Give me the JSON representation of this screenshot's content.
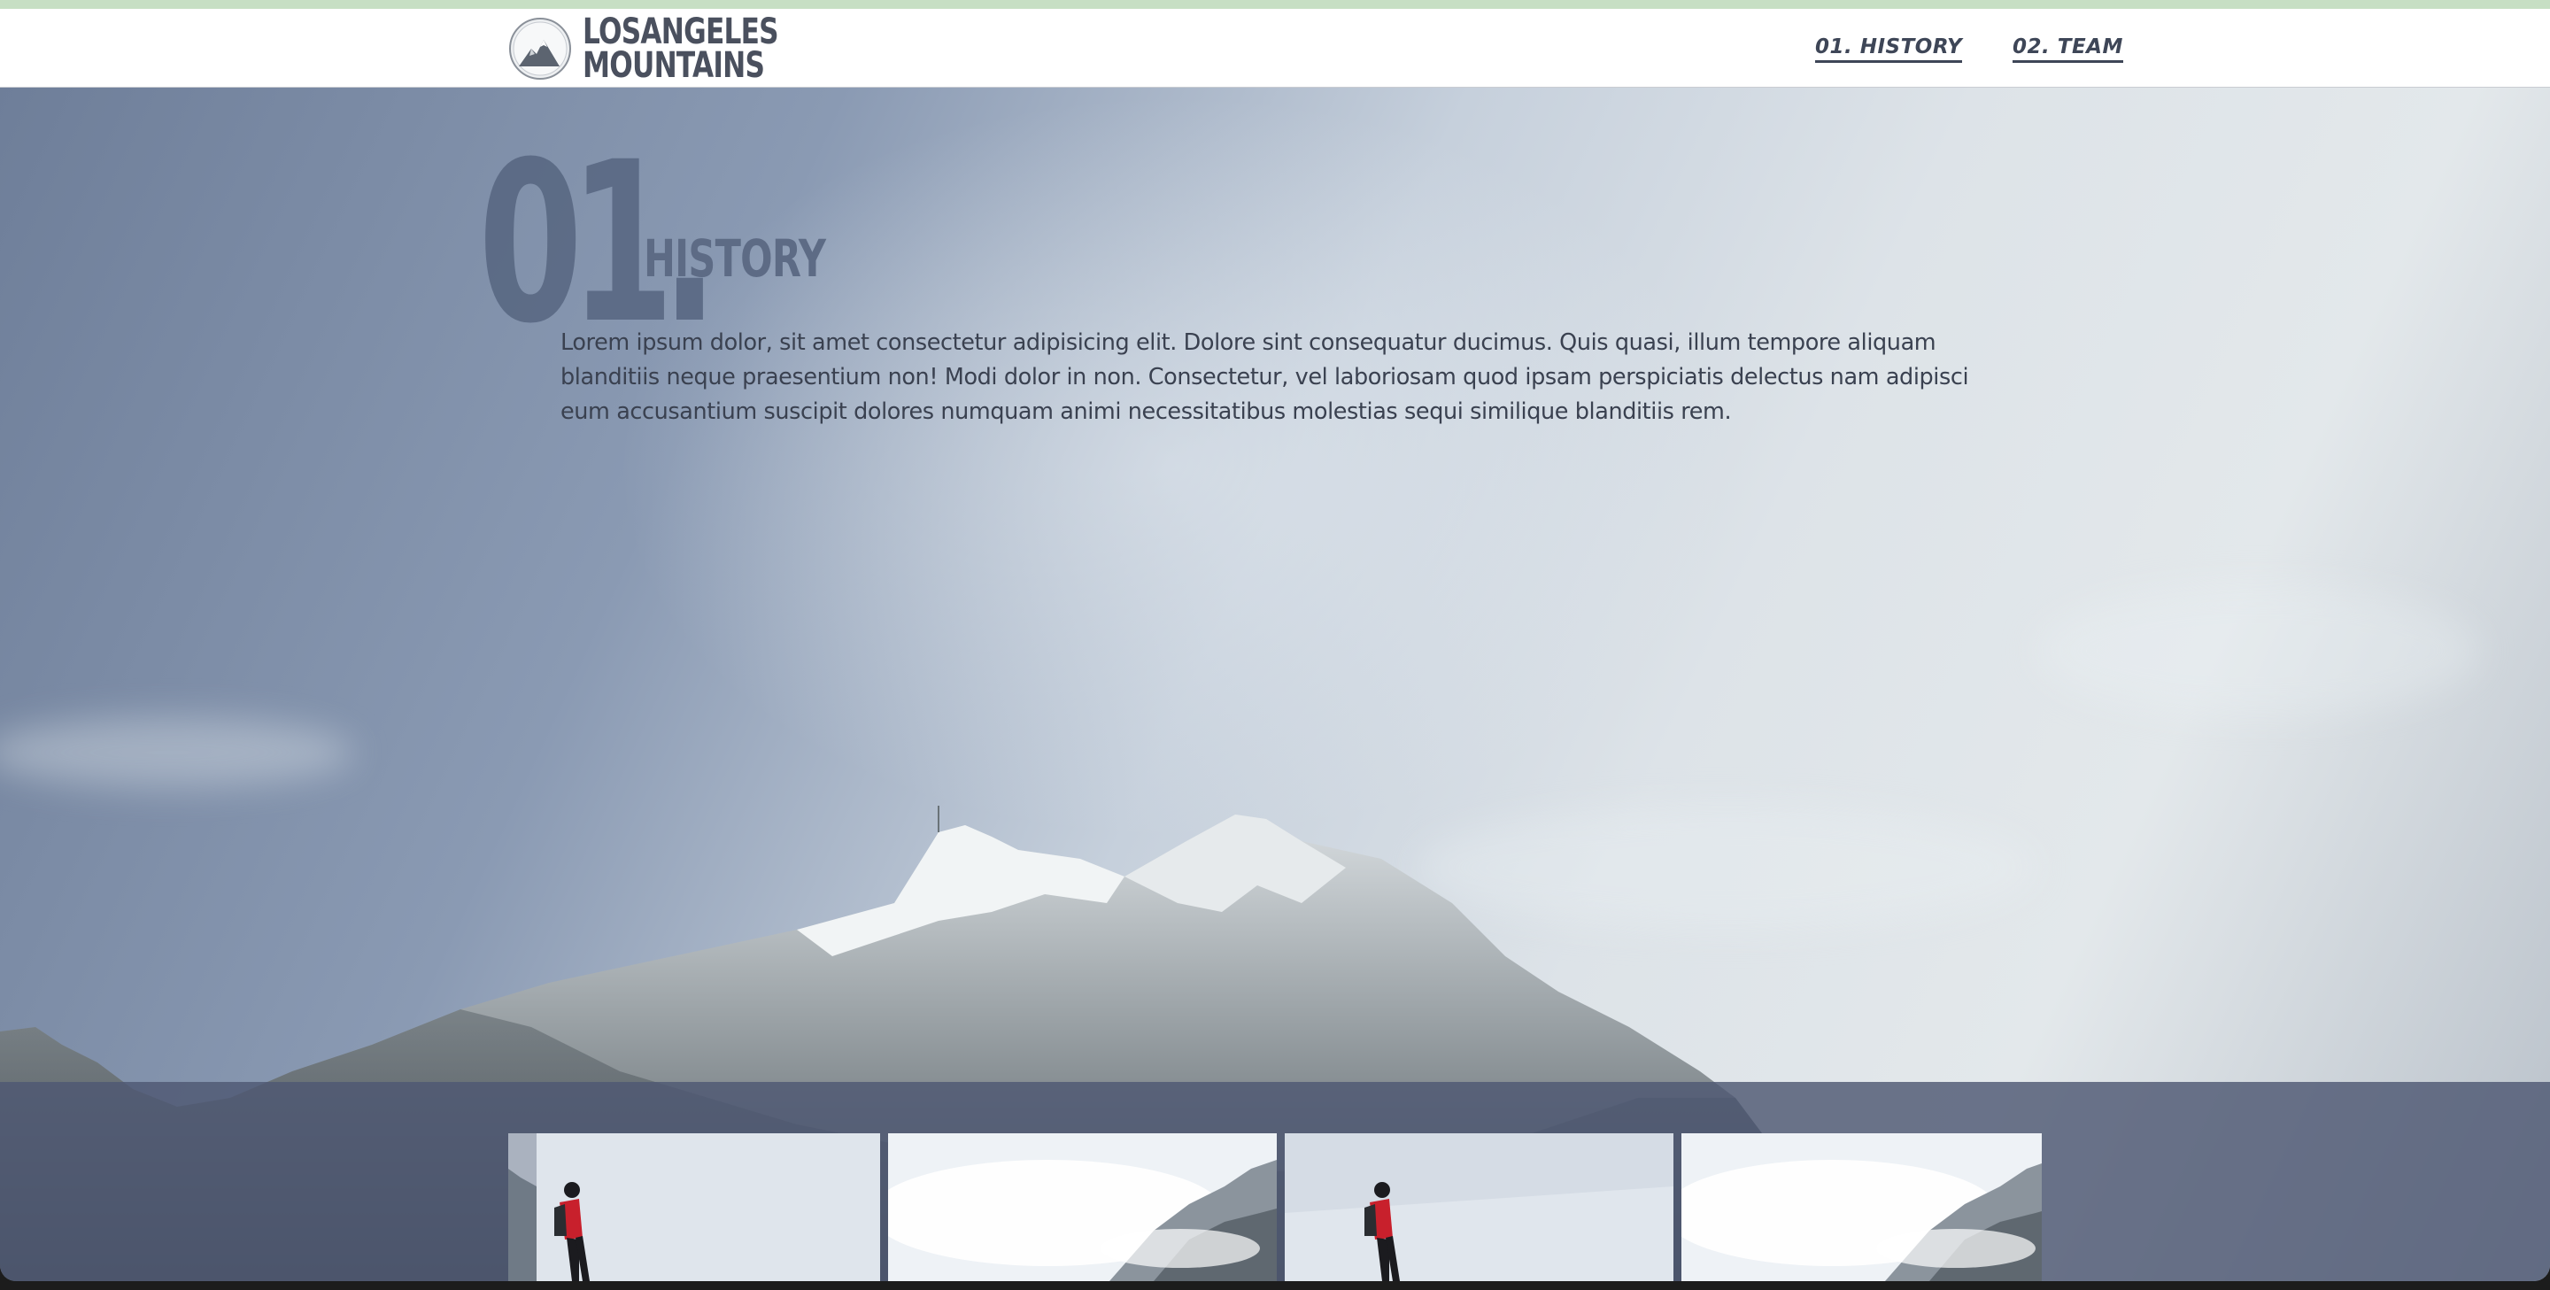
{
  "brand": {
    "line1": "LOSANGELES",
    "line2": "MOUNTAINS"
  },
  "nav": [
    {
      "label": "01. HISTORY"
    },
    {
      "label": "02. TEAM"
    }
  ],
  "section": {
    "number": "01.",
    "title": "HISTORY",
    "body": "Lorem ipsum dolor, sit amet consectetur adipisicing elit. Dolore sint consequatur ducimus. Quis quasi, illum tempore aliquam blanditiis neque praesentium non! Modi dolor in non. Consectetur, vel laboriosam quod ipsam perspiciatis delectus nam adipisci eum accusantium suscipit dolores numquam animi necessitatibus molestias sequi similique blanditiis rem."
  },
  "gallery": [
    {
      "icon": "hiker-photo"
    },
    {
      "icon": "misty-mountain-photo"
    },
    {
      "icon": "hiker-photo"
    },
    {
      "icon": "misty-mountain-photo"
    }
  ],
  "colors": {
    "accent": "#3e4657",
    "band": "#4e5873",
    "topstrip": "#c7dfc4"
  }
}
